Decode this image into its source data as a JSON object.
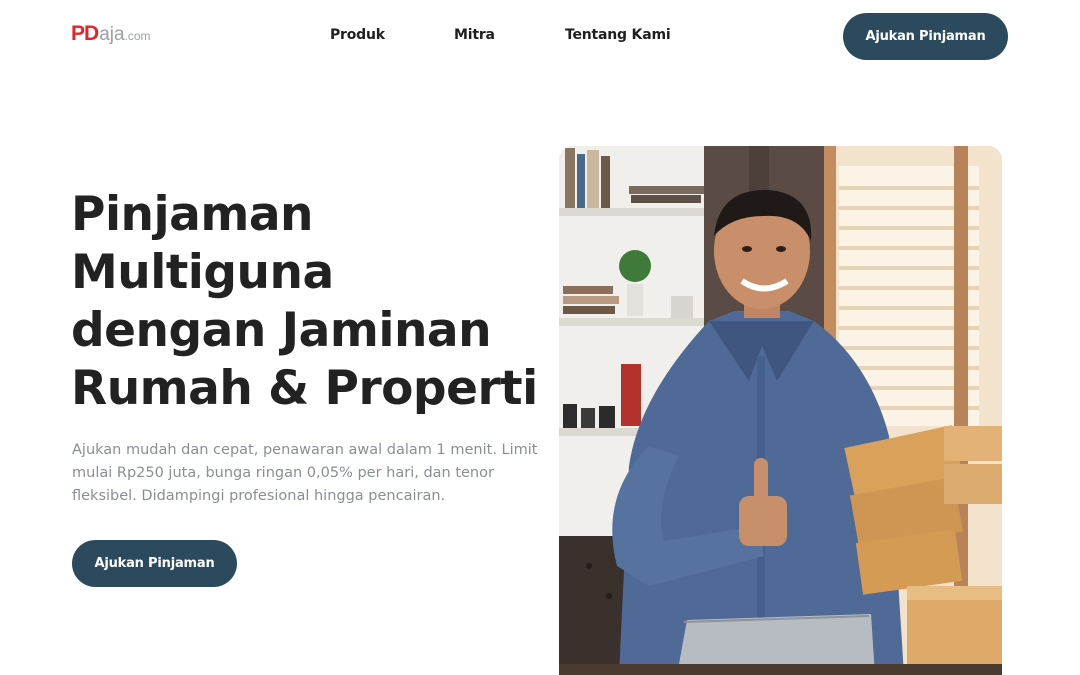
{
  "header": {
    "logo": {
      "primary": "PD",
      "secondary": "aja",
      "suffix": ".com"
    },
    "nav": [
      "Produk",
      "Mitra",
      "Tentang Kami"
    ],
    "cta_label": "Ajukan Pinjaman"
  },
  "hero": {
    "title": "Pinjaman Multiguna dengan Jaminan Rumah & Properti",
    "description": "Ajukan mudah dan cepat, penawaran awal dalam 1 menit. Limit mulai Rp250 juta, bunga ringan 0,05% per hari, dan tenor fleksibel. Didampingi profesional hingga pencairan.",
    "cta_label": "Ajukan Pinjaman"
  },
  "colors": {
    "primary_button": "#2c4a5e",
    "logo_red": "#e3262c",
    "logo_gray": "#9aa0a6",
    "body_text": "#8a8f94",
    "heading_text": "#222222"
  },
  "icons": [
    "hero-photo"
  ]
}
